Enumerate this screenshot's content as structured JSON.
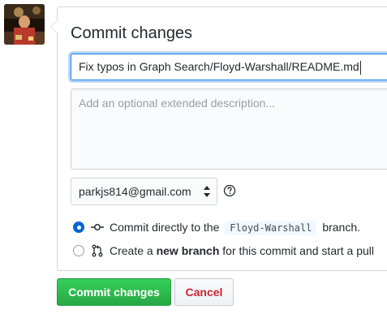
{
  "header": {
    "title": "Commit changes"
  },
  "summary": {
    "value": "Fix typos in Graph Search/Floyd-Warshall/README.md"
  },
  "description": {
    "placeholder": "Add an optional extended description..."
  },
  "author": {
    "selected_email": "parkjs814@gmail.com"
  },
  "options": {
    "direct": {
      "prefix": "Commit directly to the",
      "branch": "Floyd-Warshall",
      "suffix": "branch."
    },
    "new_branch": {
      "prefix": "Create a",
      "bold": "new branch",
      "suffix": "for this commit and start a pull"
    }
  },
  "actions": {
    "commit_label": "Commit changes",
    "cancel_label": "Cancel"
  },
  "colors": {
    "primary": "#28a745",
    "focus": "#2188ff",
    "radio": "#0366d6",
    "danger": "#cb2431"
  },
  "icons": {
    "avatar": "user-avatar",
    "help": "question-icon",
    "commit": "git-commit-icon",
    "branch": "git-pull-request-icon"
  }
}
